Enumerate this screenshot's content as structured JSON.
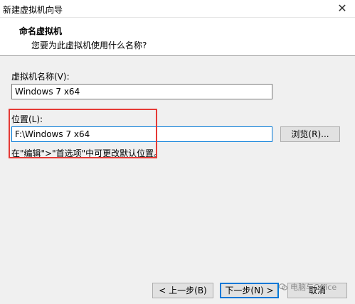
{
  "window": {
    "title": "新建虚拟机向导",
    "close_glyph": "✕"
  },
  "header": {
    "heading": "命名虚拟机",
    "subheading": "您要为此虚拟机使用什么名称?"
  },
  "vm_name": {
    "label": "虚拟机名称(V):",
    "value": "Windows 7 x64"
  },
  "location": {
    "label": "位置(L):",
    "value": "F:\\Windows 7 x64",
    "browse_label": "浏览(R)...",
    "hint": "在\"编辑\">\"首选项\"中可更改默认位置。"
  },
  "footer": {
    "back_label": "< 上一步(B)",
    "next_label": "下一步(N) >",
    "cancel_label": "取消"
  },
  "watermark": {
    "text": "电脑与Office"
  },
  "colors": {
    "highlight": "#e53935",
    "focus": "#0078d7"
  }
}
